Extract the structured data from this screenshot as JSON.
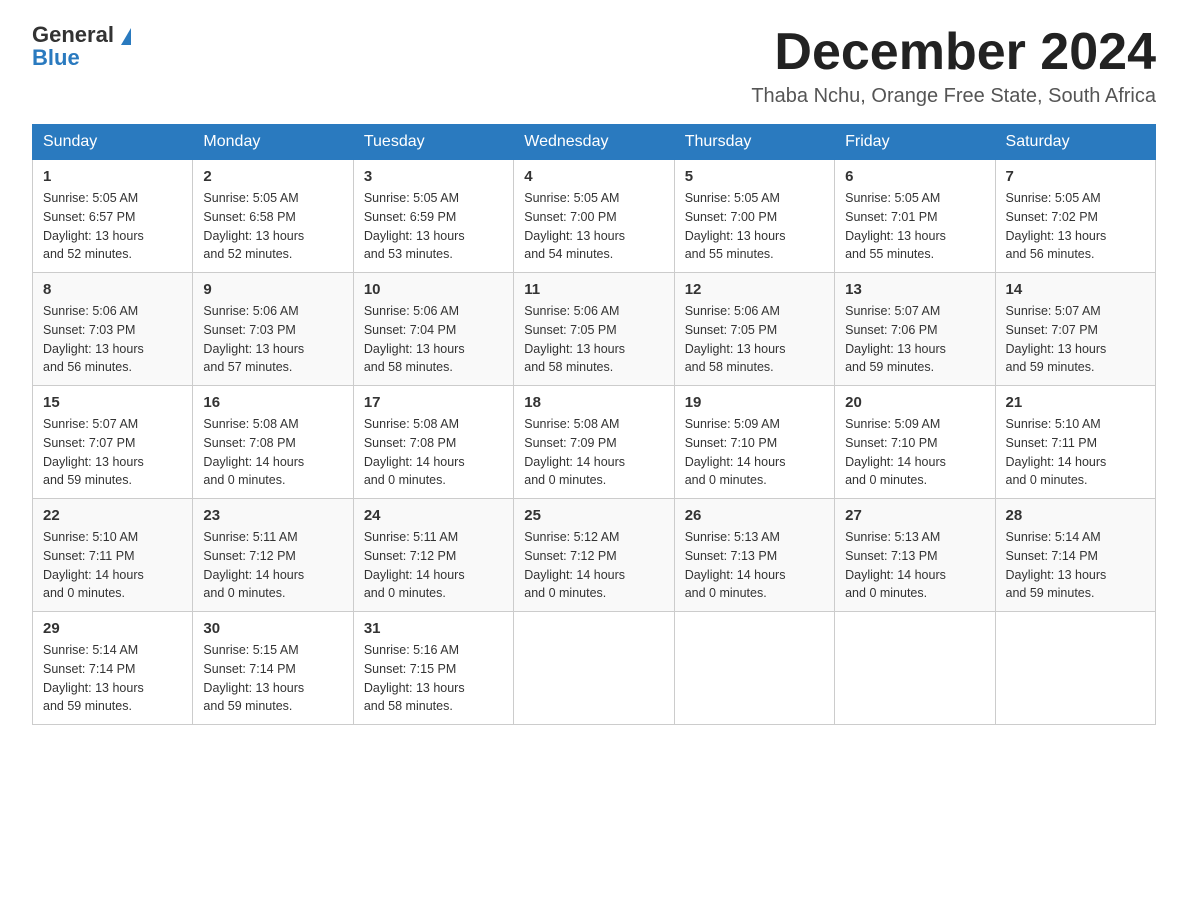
{
  "header": {
    "logo_general": "General",
    "logo_blue": "Blue",
    "month_title": "December 2024",
    "subtitle": "Thaba Nchu, Orange Free State, South Africa"
  },
  "days_of_week": [
    "Sunday",
    "Monday",
    "Tuesday",
    "Wednesday",
    "Thursday",
    "Friday",
    "Saturday"
  ],
  "weeks": [
    [
      {
        "day": 1,
        "sunrise": "5:05 AM",
        "sunset": "6:57 PM",
        "daylight": "13 hours and 52 minutes."
      },
      {
        "day": 2,
        "sunrise": "5:05 AM",
        "sunset": "6:58 PM",
        "daylight": "13 hours and 52 minutes."
      },
      {
        "day": 3,
        "sunrise": "5:05 AM",
        "sunset": "6:59 PM",
        "daylight": "13 hours and 53 minutes."
      },
      {
        "day": 4,
        "sunrise": "5:05 AM",
        "sunset": "7:00 PM",
        "daylight": "13 hours and 54 minutes."
      },
      {
        "day": 5,
        "sunrise": "5:05 AM",
        "sunset": "7:00 PM",
        "daylight": "13 hours and 55 minutes."
      },
      {
        "day": 6,
        "sunrise": "5:05 AM",
        "sunset": "7:01 PM",
        "daylight": "13 hours and 55 minutes."
      },
      {
        "day": 7,
        "sunrise": "5:05 AM",
        "sunset": "7:02 PM",
        "daylight": "13 hours and 56 minutes."
      }
    ],
    [
      {
        "day": 8,
        "sunrise": "5:06 AM",
        "sunset": "7:03 PM",
        "daylight": "13 hours and 56 minutes."
      },
      {
        "day": 9,
        "sunrise": "5:06 AM",
        "sunset": "7:03 PM",
        "daylight": "13 hours and 57 minutes."
      },
      {
        "day": 10,
        "sunrise": "5:06 AM",
        "sunset": "7:04 PM",
        "daylight": "13 hours and 58 minutes."
      },
      {
        "day": 11,
        "sunrise": "5:06 AM",
        "sunset": "7:05 PM",
        "daylight": "13 hours and 58 minutes."
      },
      {
        "day": 12,
        "sunrise": "5:06 AM",
        "sunset": "7:05 PM",
        "daylight": "13 hours and 58 minutes."
      },
      {
        "day": 13,
        "sunrise": "5:07 AM",
        "sunset": "7:06 PM",
        "daylight": "13 hours and 59 minutes."
      },
      {
        "day": 14,
        "sunrise": "5:07 AM",
        "sunset": "7:07 PM",
        "daylight": "13 hours and 59 minutes."
      }
    ],
    [
      {
        "day": 15,
        "sunrise": "5:07 AM",
        "sunset": "7:07 PM",
        "daylight": "13 hours and 59 minutes."
      },
      {
        "day": 16,
        "sunrise": "5:08 AM",
        "sunset": "7:08 PM",
        "daylight": "14 hours and 0 minutes."
      },
      {
        "day": 17,
        "sunrise": "5:08 AM",
        "sunset": "7:08 PM",
        "daylight": "14 hours and 0 minutes."
      },
      {
        "day": 18,
        "sunrise": "5:08 AM",
        "sunset": "7:09 PM",
        "daylight": "14 hours and 0 minutes."
      },
      {
        "day": 19,
        "sunrise": "5:09 AM",
        "sunset": "7:10 PM",
        "daylight": "14 hours and 0 minutes."
      },
      {
        "day": 20,
        "sunrise": "5:09 AM",
        "sunset": "7:10 PM",
        "daylight": "14 hours and 0 minutes."
      },
      {
        "day": 21,
        "sunrise": "5:10 AM",
        "sunset": "7:11 PM",
        "daylight": "14 hours and 0 minutes."
      }
    ],
    [
      {
        "day": 22,
        "sunrise": "5:10 AM",
        "sunset": "7:11 PM",
        "daylight": "14 hours and 0 minutes."
      },
      {
        "day": 23,
        "sunrise": "5:11 AM",
        "sunset": "7:12 PM",
        "daylight": "14 hours and 0 minutes."
      },
      {
        "day": 24,
        "sunrise": "5:11 AM",
        "sunset": "7:12 PM",
        "daylight": "14 hours and 0 minutes."
      },
      {
        "day": 25,
        "sunrise": "5:12 AM",
        "sunset": "7:12 PM",
        "daylight": "14 hours and 0 minutes."
      },
      {
        "day": 26,
        "sunrise": "5:13 AM",
        "sunset": "7:13 PM",
        "daylight": "14 hours and 0 minutes."
      },
      {
        "day": 27,
        "sunrise": "5:13 AM",
        "sunset": "7:13 PM",
        "daylight": "14 hours and 0 minutes."
      },
      {
        "day": 28,
        "sunrise": "5:14 AM",
        "sunset": "7:14 PM",
        "daylight": "13 hours and 59 minutes."
      }
    ],
    [
      {
        "day": 29,
        "sunrise": "5:14 AM",
        "sunset": "7:14 PM",
        "daylight": "13 hours and 59 minutes."
      },
      {
        "day": 30,
        "sunrise": "5:15 AM",
        "sunset": "7:14 PM",
        "daylight": "13 hours and 59 minutes."
      },
      {
        "day": 31,
        "sunrise": "5:16 AM",
        "sunset": "7:15 PM",
        "daylight": "13 hours and 58 minutes."
      },
      null,
      null,
      null,
      null
    ]
  ],
  "labels": {
    "sunrise": "Sunrise:",
    "sunset": "Sunset:",
    "daylight": "Daylight:"
  }
}
